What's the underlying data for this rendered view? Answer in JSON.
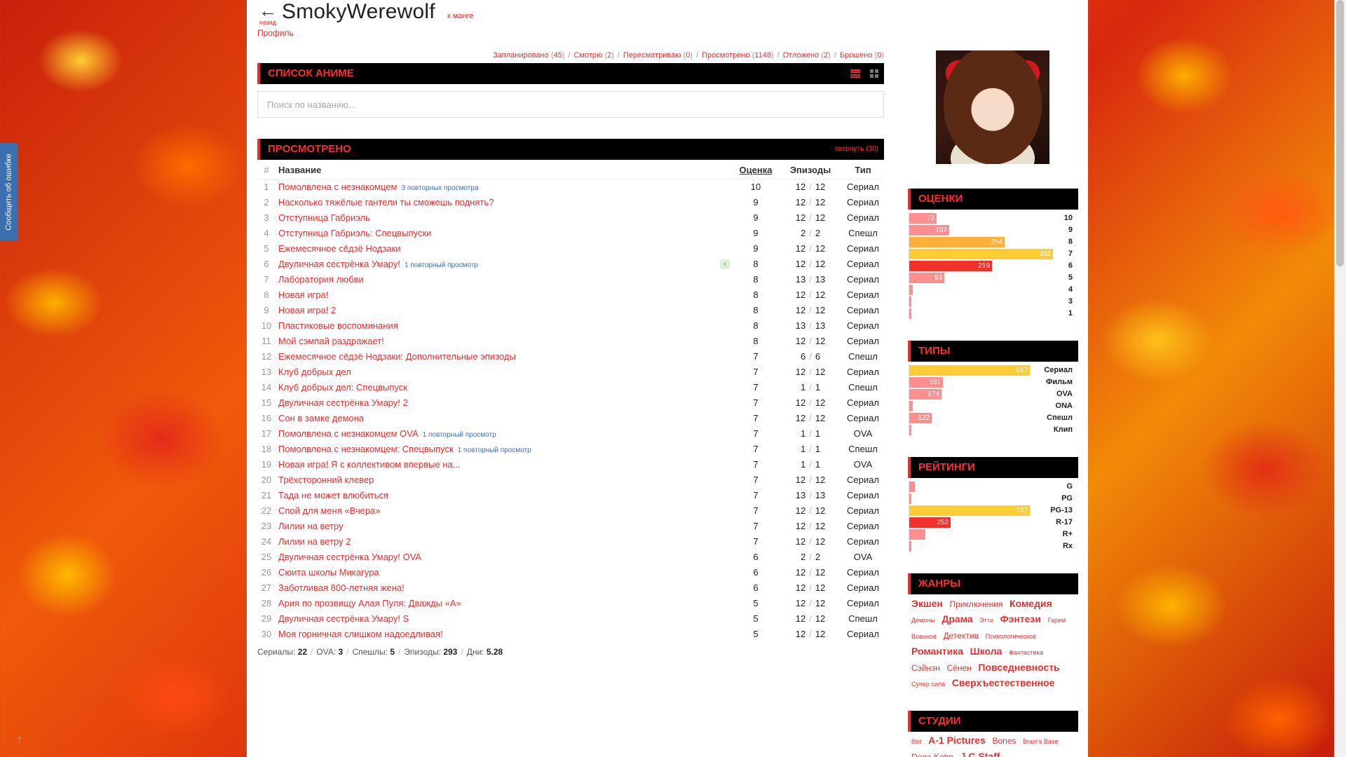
{
  "colors": {
    "accent": "#e53030",
    "link_blue": "#3a6fc4",
    "bar_yellow": "#ffcc33",
    "bar_pink": "#ff8f8f",
    "bar_orange": "#ffb03a",
    "bar_red": "#f0322a"
  },
  "report_tab": "Сообщить об ошибке",
  "to_top_icon": "arrow-up-icon",
  "header": {
    "back_label": "назад",
    "username": "SmokyWerewolf",
    "to_manga": "к манге",
    "profile": "Профиль"
  },
  "statuses": [
    {
      "label": "Запланировано",
      "count": "45"
    },
    {
      "label": "Смотрю",
      "count": "2"
    },
    {
      "label": "Пересматриваю",
      "count": "0"
    },
    {
      "label": "Просмотрено",
      "count": "1148"
    },
    {
      "label": "Отложено",
      "count": "2"
    },
    {
      "label": "Брошено",
      "count": "0"
    }
  ],
  "anime_list": {
    "title": "Список аниме",
    "search_placeholder": "Поиск по названию..."
  },
  "watched": {
    "title": "Просмотрено",
    "collapse": "свернуть (30)",
    "columns": {
      "num": "#",
      "title": "Название",
      "score": "Оценка",
      "episodes": "Эпизоды",
      "type": "Тип"
    },
    "rows": [
      {
        "n": "1",
        "title": "Помолвлена с незнакомцем",
        "rewatch": "3 повторных просмотра",
        "score": "10",
        "ep": "12",
        "total": "12",
        "type": "Сериал"
      },
      {
        "n": "2",
        "title": "Насколько тяжёлые гантели ты сможешь поднять?",
        "rewatch": "",
        "score": "9",
        "ep": "12",
        "total": "12",
        "type": "Сериал"
      },
      {
        "n": "3",
        "title": "Отступница Габриэль",
        "rewatch": "",
        "score": "9",
        "ep": "12",
        "total": "12",
        "type": "Сериал"
      },
      {
        "n": "4",
        "title": "Отступница Габриэль: Спецвыпуски",
        "rewatch": "",
        "score": "9",
        "ep": "2",
        "total": "2",
        "type": "Спешл"
      },
      {
        "n": "5",
        "title": "Ежемесячное сёдзё Нодзаки",
        "rewatch": "",
        "score": "9",
        "ep": "12",
        "total": "12",
        "type": "Сериал"
      },
      {
        "n": "6",
        "title": "Двуличная сестрёнка Умару!",
        "rewatch": "1 повторный просмотр",
        "score": "8",
        "ep": "12",
        "total": "12",
        "type": "Сериал",
        "mark": "+"
      },
      {
        "n": "7",
        "title": "Лаборатория любви",
        "rewatch": "",
        "score": "8",
        "ep": "13",
        "total": "13",
        "type": "Сериал"
      },
      {
        "n": "8",
        "title": "Новая игра!",
        "rewatch": "",
        "score": "8",
        "ep": "12",
        "total": "12",
        "type": "Сериал"
      },
      {
        "n": "9",
        "title": "Новая игра! 2",
        "rewatch": "",
        "score": "8",
        "ep": "12",
        "total": "12",
        "type": "Сериал"
      },
      {
        "n": "10",
        "title": "Пластиковые воспоминания",
        "rewatch": "",
        "score": "8",
        "ep": "13",
        "total": "13",
        "type": "Сериал"
      },
      {
        "n": "11",
        "title": "Мой сэмпай раздражает!",
        "rewatch": "",
        "score": "8",
        "ep": "12",
        "total": "12",
        "type": "Сериал"
      },
      {
        "n": "12",
        "title": "Ежемесячное сёдзё Нодзаки: Дополнительные эпизоды",
        "rewatch": "",
        "score": "7",
        "ep": "6",
        "total": "6",
        "type": "Спешл"
      },
      {
        "n": "13",
        "title": "Клуб добрых дел",
        "rewatch": "",
        "score": "7",
        "ep": "12",
        "total": "12",
        "type": "Сериал"
      },
      {
        "n": "14",
        "title": "Клуб добрых дел: Спецвыпуск",
        "rewatch": "",
        "score": "7",
        "ep": "1",
        "total": "1",
        "type": "Спешл"
      },
      {
        "n": "15",
        "title": "Двуличная сестрёнка Умару! 2",
        "rewatch": "",
        "score": "7",
        "ep": "12",
        "total": "12",
        "type": "Сериал"
      },
      {
        "n": "16",
        "title": "Сон в замке демона",
        "rewatch": "",
        "score": "7",
        "ep": "12",
        "total": "12",
        "type": "Сериал"
      },
      {
        "n": "17",
        "title": "Помолвлена с незнакомцем OVA",
        "rewatch": "1 повторный просмотр",
        "score": "7",
        "ep": "1",
        "total": "1",
        "type": "OVA"
      },
      {
        "n": "18",
        "title": "Помолвлена с незнакомцем: Спецвыпуск",
        "rewatch": "1 повторный просмотр",
        "score": "7",
        "ep": "1",
        "total": "1",
        "type": "Спешл"
      },
      {
        "n": "19",
        "title": "Новая игра! Я с коллективом впервые на...",
        "rewatch": "",
        "score": "7",
        "ep": "1",
        "total": "1",
        "type": "OVA"
      },
      {
        "n": "20",
        "title": "Трёхсторонний клевер",
        "rewatch": "",
        "score": "7",
        "ep": "12",
        "total": "12",
        "type": "Сериал"
      },
      {
        "n": "21",
        "title": "Тада не может влюбиться",
        "rewatch": "",
        "score": "7",
        "ep": "13",
        "total": "13",
        "type": "Сериал"
      },
      {
        "n": "22",
        "title": "Спой для меня «Вчера»",
        "rewatch": "",
        "score": "7",
        "ep": "12",
        "total": "12",
        "type": "Сериал"
      },
      {
        "n": "23",
        "title": "Лилии на ветру",
        "rewatch": "",
        "score": "7",
        "ep": "12",
        "total": "12",
        "type": "Сериал"
      },
      {
        "n": "24",
        "title": "Лилии на ветру 2",
        "rewatch": "",
        "score": "7",
        "ep": "12",
        "total": "12",
        "type": "Сериал"
      },
      {
        "n": "25",
        "title": "Двуличная сестрёнка Умару! OVA",
        "rewatch": "",
        "score": "6",
        "ep": "2",
        "total": "2",
        "type": "OVA"
      },
      {
        "n": "26",
        "title": "Сюита школы Микагура",
        "rewatch": "",
        "score": "6",
        "ep": "12",
        "total": "12",
        "type": "Сериал"
      },
      {
        "n": "27",
        "title": "Заботливая 800-летняя жена!",
        "rewatch": "",
        "score": "6",
        "ep": "12",
        "total": "12",
        "type": "Сериал"
      },
      {
        "n": "28",
        "title": "Ария по прозвищу Алая Пуля: Дважды «А»",
        "rewatch": "",
        "score": "5",
        "ep": "12",
        "total": "12",
        "type": "Сериал"
      },
      {
        "n": "29",
        "title": "Двуличная сестрёнка Умару! S",
        "rewatch": "",
        "score": "5",
        "ep": "12",
        "total": "12",
        "type": "Спешл"
      },
      {
        "n": "30",
        "title": "Моя горничная слишком надоедливая!",
        "rewatch": "",
        "score": "5",
        "ep": "12",
        "total": "12",
        "type": "Сериал"
      }
    ],
    "totals": [
      {
        "label": "Сериалы:",
        "value": "22"
      },
      {
        "label": "OVA:",
        "value": "3"
      },
      {
        "label": "Спешлы:",
        "value": "5"
      },
      {
        "label": "Эпизоды:",
        "value": "293"
      },
      {
        "label": "Дни:",
        "value": "5.28"
      }
    ]
  },
  "scores": {
    "title": "Оценки",
    "max": 382,
    "items": [
      {
        "label": "10",
        "value": 73,
        "text": "73",
        "color": "#ff8f8f"
      },
      {
        "label": "9",
        "value": 107,
        "text": "107",
        "color": "#ff8f8f"
      },
      {
        "label": "8",
        "value": 254,
        "text": "254",
        "color": "#ffb03a"
      },
      {
        "label": "7",
        "value": 382,
        "text": "382",
        "color": "#ffcc33"
      },
      {
        "label": "6",
        "value": 219,
        "text": "219",
        "color": "#f0322a"
      },
      {
        "label": "5",
        "value": 93,
        "text": "93",
        "color": "#ff8f8f"
      },
      {
        "label": "4",
        "value": 10,
        "text": "",
        "color": "#ff8f8f"
      },
      {
        "label": "3",
        "value": 3,
        "text": "",
        "color": "#ff8f8f"
      },
      {
        "label": "1",
        "value": 2,
        "text": "",
        "color": "#ff8f8f"
      }
    ]
  },
  "types": {
    "title": "Типы",
    "max": 647,
    "items": [
      {
        "label": "Сериал",
        "value": 647,
        "text": "647",
        "color": "#ffcc33"
      },
      {
        "label": "Фильм",
        "value": 181,
        "text": "181",
        "color": "#ff8f8f"
      },
      {
        "label": "OVA",
        "value": 174,
        "text": "174",
        "color": "#ff8f8f"
      },
      {
        "label": "ONA",
        "value": 20,
        "text": "",
        "color": "#ff8f8f"
      },
      {
        "label": "Спешл",
        "value": 122,
        "text": "122",
        "color": "#ff8f8f"
      },
      {
        "label": "Клип",
        "value": 3,
        "text": "",
        "color": "#ff8f8f"
      }
    ]
  },
  "ratings": {
    "title": "Рейтинги",
    "max": 737,
    "items": [
      {
        "label": "G",
        "value": 35,
        "text": "",
        "color": "#ff8f8f"
      },
      {
        "label": "PG",
        "value": 5,
        "text": "",
        "color": "#ff8f8f"
      },
      {
        "label": "PG-13",
        "value": 737,
        "text": "737",
        "color": "#ffcc33"
      },
      {
        "label": "R-17",
        "value": 252,
        "text": "252",
        "color": "#f0322a"
      },
      {
        "label": "R+",
        "value": 100,
        "text": "",
        "color": "#ff8f8f"
      },
      {
        "label": "Rx",
        "value": 4,
        "text": "",
        "color": "#ff8f8f"
      }
    ]
  },
  "genres": {
    "title": "Жанры",
    "tags": [
      {
        "t": "Экшен",
        "s": "lg"
      },
      {
        "t": "Приключения",
        "s": "md"
      },
      {
        "t": "Комедия",
        "s": "lg"
      },
      {
        "t": "Демоны",
        "s": "sm"
      },
      {
        "t": "Драма",
        "s": "lg"
      },
      {
        "t": "Этти",
        "s": "sm"
      },
      {
        "t": "Фэнтези",
        "s": "lg"
      },
      {
        "t": "Гарем",
        "s": "sm"
      },
      {
        "t": "Военное",
        "s": "sm"
      },
      {
        "t": "Детектив",
        "s": "md"
      },
      {
        "t": "Психологическое",
        "s": "sm"
      },
      {
        "t": "Романтика",
        "s": "lg"
      },
      {
        "t": "Школа",
        "s": "lg"
      },
      {
        "t": "Фантастика",
        "s": "sm"
      },
      {
        "t": "Сэйнэн",
        "s": "md"
      },
      {
        "t": "Сёнен",
        "s": "md"
      },
      {
        "t": "Повседневность",
        "s": "lg"
      },
      {
        "t": "Супер сила",
        "s": "sm"
      },
      {
        "t": "Сверхъестественное",
        "s": "lg"
      }
    ]
  },
  "studios": {
    "title": "Студии",
    "tags": [
      {
        "t": "8bit",
        "s": "sm"
      },
      {
        "t": "A-1 Pictures",
        "s": "lg"
      },
      {
        "t": "Bones",
        "s": "md"
      },
      {
        "t": "Brain's Base",
        "s": "sm"
      },
      {
        "t": "Doga Kobo",
        "s": "md"
      },
      {
        "t": "J.C.Staff",
        "s": "lg"
      }
    ]
  }
}
